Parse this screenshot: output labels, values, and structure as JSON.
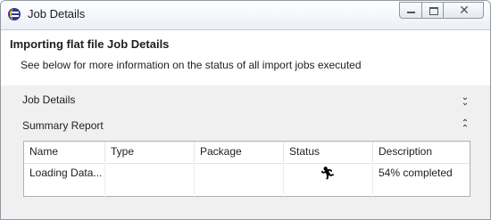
{
  "window": {
    "title": "Job Details",
    "icon": "eclipse-icon"
  },
  "header": {
    "title": "Importing flat file Job Details",
    "description": "See below for more information on the status of all import jobs executed"
  },
  "sections": {
    "job_details": {
      "label": "Job Details",
      "expanded": false
    },
    "summary_report": {
      "label": "Summary Report",
      "expanded": true
    }
  },
  "table": {
    "columns": [
      "Name",
      "Type",
      "Package",
      "Status",
      "Description"
    ],
    "rows": [
      {
        "name": "Loading Data...",
        "type": "",
        "package": "",
        "status_icon": "running-man-icon",
        "description": "54% completed",
        "progress_percent": 54
      }
    ]
  }
}
